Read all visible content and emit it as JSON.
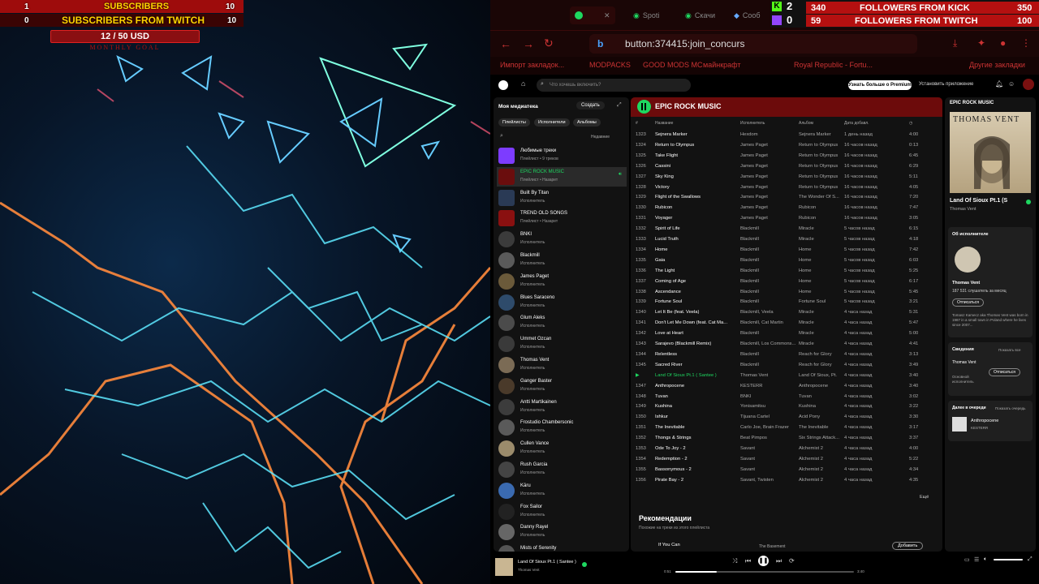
{
  "overlay": {
    "subs_count": "1",
    "subs_label": "SUBSCRIBERS",
    "subs_value": "10",
    "twitch_count": "0",
    "twitch_label": "SUBSCRIBERS FROM TWITCH",
    "twitch_value": "10",
    "goal": "12 / 50 USD",
    "goal_sub": "MONTHLY GOAL"
  },
  "kick_widget": {
    "kick_count": "2",
    "twitch_count": "0",
    "kick_current": "340",
    "kick_label": "FOLLOWERS FROM KICK",
    "kick_goal": "350",
    "twitch_current": "59",
    "twitch_label": "FOLLOWERS FROM TWITCH",
    "twitch_goal": "100"
  },
  "browser": {
    "tabs": [
      "Spoti",
      "Скачи",
      "Сооб"
    ],
    "url": "button:374415:join_concurs",
    "bookmarks": [
      "Импорт закладок...",
      "MODPACKS",
      "GOOD MODS MC",
      "майнкрафт",
      "Royal Republic - Fortu...",
      "Другие закладки"
    ]
  },
  "spotify": {
    "search_placeholder": "Что хочешь включить?",
    "premium": "Узнать больше о Premium",
    "install_app": "Установить приложение",
    "library": {
      "title": "Моя медиатека",
      "create": "Создать",
      "filters": [
        "Плейлисты",
        "Исполнители",
        "Альбомы"
      ],
      "sort": "Недавние",
      "items": [
        {
          "title": "Любимые треки",
          "sub": "Плейлист • 9 треков"
        },
        {
          "title": "EPIC ROCK MUSIC",
          "sub": "Плейлист • Назарет"
        },
        {
          "title": "Built By Titan",
          "sub": "Исполнитель"
        },
        {
          "title": "TREND OLD SONGS",
          "sub": "Плейлист • Назарет"
        },
        {
          "title": "BNKI",
          "sub": "Исполнитель"
        },
        {
          "title": "Blackmill",
          "sub": "Исполнитель"
        },
        {
          "title": "James Paget",
          "sub": "Исполнитель"
        },
        {
          "title": "Blues Saraceno",
          "sub": "Исполнитель"
        },
        {
          "title": "Glum Aleks",
          "sub": "Исполнитель"
        },
        {
          "title": "Ummet Ozcan",
          "sub": "Исполнитель"
        },
        {
          "title": "Thomas Vent",
          "sub": "Исполнитель"
        },
        {
          "title": "Ganger Baster",
          "sub": "Исполнитель"
        },
        {
          "title": "Antti Martikainen",
          "sub": "Исполнитель"
        },
        {
          "title": "Frostudio Chambersonic",
          "sub": "Исполнитель"
        },
        {
          "title": "Cullen Vance",
          "sub": "Исполнитель"
        },
        {
          "title": "Rush Garcia",
          "sub": "Исполнитель"
        },
        {
          "title": "Kāru",
          "sub": "Исполнитель"
        },
        {
          "title": "Fox Sailor",
          "sub": "Исполнитель"
        },
        {
          "title": "Danny Rayel",
          "sub": "Исполнитель"
        },
        {
          "title": "Mists of Serenity",
          "sub": "Исполнитель"
        }
      ]
    },
    "playlist": {
      "title": "EPIC ROCK MUSIC",
      "columns": [
        "#",
        "Название",
        "Исполнитель",
        "Альбом",
        "Дата добавл.",
        "◷"
      ],
      "rows": [
        [
          "1323",
          "Sejnera Marker",
          "Hexdom",
          "Sejnera Marker",
          "1 день назад",
          "4:00"
        ],
        [
          "1324",
          "Return to Olympus",
          "James Paget",
          "Return to Olympus",
          "16 часов назад",
          "0:13"
        ],
        [
          "1325",
          "Take Flight",
          "James Paget",
          "Return to Olympus",
          "16 часов назад",
          "6:45"
        ],
        [
          "1326",
          "Cassini",
          "James Paget",
          "Return to Olympus",
          "16 часов назад",
          "6:29"
        ],
        [
          "1327",
          "Sky King",
          "James Paget",
          "Return to Olympus",
          "16 часов назад",
          "5:11"
        ],
        [
          "1328",
          "Victory",
          "James Paget",
          "Return to Olympus",
          "16 часов назад",
          "4:05"
        ],
        [
          "1329",
          "Flight of the Swallows",
          "James Paget",
          "The Wonder Of S...",
          "16 часов назад",
          "7:20"
        ],
        [
          "1330",
          "Rubicon",
          "James Paget",
          "Rubicon",
          "16 часов назад",
          "7:47"
        ],
        [
          "1331",
          "Voyager",
          "James Paget",
          "Rubicon",
          "16 часов назад",
          "3:05"
        ],
        [
          "1332",
          "Spirit of Life",
          "Blackmill",
          "Miracle",
          "5 часов назад",
          "6:15"
        ],
        [
          "1333",
          "Lucid Truth",
          "Blackmill",
          "Miracle",
          "5 часов назад",
          "4:18"
        ],
        [
          "1334",
          "Home",
          "Blackmill",
          "Home",
          "5 часов назад",
          "7:42"
        ],
        [
          "1335",
          "Gaia",
          "Blackmill",
          "Home",
          "5 часов назад",
          "6:03"
        ],
        [
          "1336",
          "The Light",
          "Blackmill",
          "Home",
          "5 часов назад",
          "5:25"
        ],
        [
          "1337",
          "Coming of Age",
          "Blackmill",
          "Home",
          "5 часов назад",
          "6:17"
        ],
        [
          "1338",
          "Ascendance",
          "Blackmill",
          "Home",
          "5 часов назад",
          "5:45"
        ],
        [
          "1339",
          "Fortune Soul",
          "Blackmill",
          "Fortune Soul",
          "5 часов назад",
          "3:21"
        ],
        [
          "1340",
          "Let It Be (feat. Veela)",
          "Blackmill, Veela",
          "Miracle",
          "4 часа назад",
          "5:31"
        ],
        [
          "1341",
          "Don't Let Me Down (feat. Cat Ma...",
          "Blackmill, Cat Martin",
          "Miracle",
          "4 часа назад",
          "5:47"
        ],
        [
          "1342",
          "Love at Heart",
          "Blackmill",
          "Miracle",
          "4 часа назад",
          "5:00"
        ],
        [
          "1343",
          "Sarajevo (Blackmill Remix)",
          "Blackmill, Los Commons...",
          "Miracle",
          "4 часа назад",
          "4:41"
        ],
        [
          "1344",
          "Relentless",
          "Blackmill",
          "Reach for Glory",
          "4 часа назад",
          "3:13"
        ],
        [
          "1345",
          "Sacred River",
          "Blackmill",
          "Reach for Glory",
          "4 часа назад",
          "3:49"
        ],
        [
          "▶",
          "Land Of Sioux Pt.1 ( Santee )",
          "Thomas Vent",
          "Land Of Sioux, Pt.",
          "4 часа назад",
          "3:40"
        ],
        [
          "1347",
          "Anthropocene",
          "KESTERR",
          "Anthropocene",
          "4 часа назад",
          "3:40"
        ],
        [
          "1348",
          "Tuvan",
          "BNKI",
          "Tuvan",
          "4 часа назад",
          "3:02"
        ],
        [
          "1349",
          "Kushina",
          "Yonisamitsu",
          "Kushina",
          "4 часа назад",
          "3:22"
        ],
        [
          "1350",
          "Ishkur",
          "Tijuana Cartel",
          "Acid Pony",
          "4 часа назад",
          "3:30"
        ],
        [
          "1351",
          "The Inevitable",
          "Carlo Joe, Brain Frazer",
          "The Inevitable",
          "4 часа назад",
          "3:17"
        ],
        [
          "1352",
          "Thongs & Strings",
          "Beat Pimpos",
          "Six Strings Attack...",
          "4 часа назад",
          "3:37"
        ],
        [
          "1353",
          "Ode To Joy - 2",
          "Savant",
          "Alchemist 2",
          "4 часа назад",
          "4:00"
        ],
        [
          "1354",
          "Redemption - 2",
          "Savant",
          "Alchemist 2",
          "4 часа назад",
          "5:22"
        ],
        [
          "1355",
          "Bassonymous - 2",
          "Savant",
          "Alchemist 2",
          "4 часа назад",
          "4:34"
        ],
        [
          "1356",
          "Pirate Bay - 2",
          "Savant, Twisten",
          "Alchemist 2",
          "4 часа назад",
          "4:35"
        ]
      ],
      "more": "Ещё",
      "rec_title": "Рекомендации",
      "rec_sub": "Похожие на треки из этого плейлиста",
      "rec_track": "If You Can",
      "rec_album": "The Basement",
      "rec_add": "Добавить"
    },
    "now_playing": {
      "panel_title": "EPIC ROCK MUSIC",
      "art_text": "THOMAS VENT",
      "title": "Land Of Sioux Pt.1 (S",
      "artist": "Thomas Vent",
      "about": "Об исполнителе",
      "artist_name": "Thomas Vent",
      "listeners": "187 531 слушатель за месяц",
      "unfollow": "Отписаться",
      "bio": "Tomasz Kamecz aka Thomas Vent was born in 1987 in a small town in Poland where he lives since 2007...",
      "credits": "Сведения",
      "show_all": "Показать все",
      "credit_name": "Thomas Vent",
      "credit_role": "Основной исполнитель",
      "credit_btn": "Отписаться",
      "next_label": "Далее в очереди",
      "open_queue": "Показать очередь",
      "next_track": "Anthropocene",
      "next_artist": "KESTERR"
    },
    "player": {
      "title": "Land Of Sioux Pt.1 ( Santee )",
      "artist": "Thomas Vent",
      "elapsed": "0:51",
      "total": "3:40",
      "progress": 0.23
    }
  }
}
